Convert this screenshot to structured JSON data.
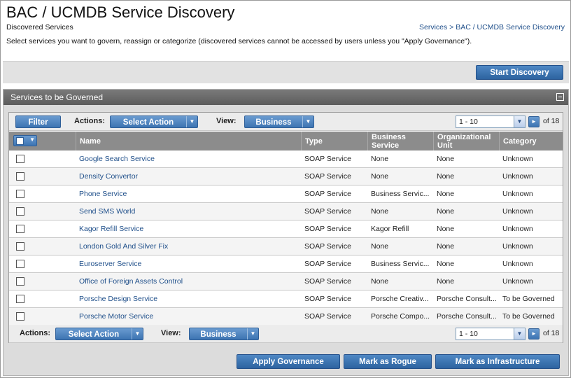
{
  "header": {
    "title": "BAC / UCMDB Service Discovery",
    "subtitle": "Discovered Services",
    "breadcrumb": "Services > BAC / UCMDB Service Discovery",
    "instructions": "Select services you want to govern, reassign or categorize (discovered services cannot be accessed by users unless you \"Apply Governance\")."
  },
  "topbar": {
    "start_discovery_label": "Start Discovery"
  },
  "panel": {
    "title": "Services to be Governed"
  },
  "toolbar": {
    "filter_label": "Filter",
    "actions_label": "Actions:",
    "select_action_label": "Select Action",
    "view_label": "View:",
    "view_value": "Business",
    "page_range": "1 - 10",
    "of_total": "of 18"
  },
  "table": {
    "columns": [
      "Name",
      "Type",
      "Business Service",
      "Organizational Unit",
      "Category"
    ],
    "rows": [
      {
        "name": "Google Search Service",
        "type": "SOAP Service",
        "business": "None",
        "org": "None",
        "category": "Unknown"
      },
      {
        "name": "Density Convertor",
        "type": "SOAP Service",
        "business": "None",
        "org": "None",
        "category": "Unknown"
      },
      {
        "name": "Phone Service",
        "type": "SOAP Service",
        "business": "Business Servic...",
        "org": "None",
        "category": "Unknown"
      },
      {
        "name": "Send SMS World",
        "type": "SOAP Service",
        "business": "None",
        "org": "None",
        "category": "Unknown"
      },
      {
        "name": "Kagor Refill Service",
        "type": "SOAP Service",
        "business": "Kagor Refill",
        "org": "None",
        "category": "Unknown"
      },
      {
        "name": "London Gold And Silver Fix",
        "type": "SOAP Service",
        "business": "None",
        "org": "None",
        "category": "Unknown"
      },
      {
        "name": "Euroserver Service",
        "type": "SOAP Service",
        "business": "Business Servic...",
        "org": "None",
        "category": "Unknown"
      },
      {
        "name": "Office of Foreign Assets Control",
        "type": "SOAP Service",
        "business": "None",
        "org": "None",
        "category": "Unknown"
      },
      {
        "name": "Porsche Design Service",
        "type": "SOAP Service",
        "business": "Porsche Creativ...",
        "org": "Porsche Consult...",
        "category": "To be Governed"
      },
      {
        "name": "Porsche Motor Service",
        "type": "SOAP Service",
        "business": "Porsche Compo...",
        "org": "Porsche Consult...",
        "category": "To be Governed"
      }
    ]
  },
  "footer": {
    "apply_governance_label": "Apply Governance",
    "mark_rogue_label": "Mark as Rogue",
    "mark_infrastructure_label": "Mark as Infrastructure"
  },
  "colors": {
    "accent": "#3d74b2",
    "header_bar": "#8c8c8c",
    "link": "#1f4f8a"
  }
}
